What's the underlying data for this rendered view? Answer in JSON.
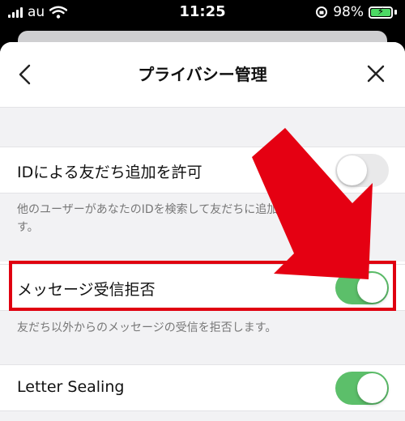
{
  "status_bar": {
    "carrier": "au",
    "time": "11:25",
    "battery": "98%"
  },
  "header": {
    "title": "プライバシー管理"
  },
  "settings": [
    {
      "label": "IDによる友だち追加を許可",
      "enabled": false,
      "description": "他のユーザーがあなたのIDを検索して友だちに追加することができます。"
    },
    {
      "label": "メッセージ受信拒否",
      "enabled": true,
      "description": "友だち以外からのメッセージの受信を拒否します。"
    },
    {
      "label": "Letter Sealing",
      "enabled": true
    }
  ],
  "colors": {
    "toggle_on": "#5cbf6a",
    "highlight": "#e00010"
  },
  "icons": {
    "back": "chevron-left-icon",
    "close": "close-icon",
    "annotation": "red-arrow"
  }
}
